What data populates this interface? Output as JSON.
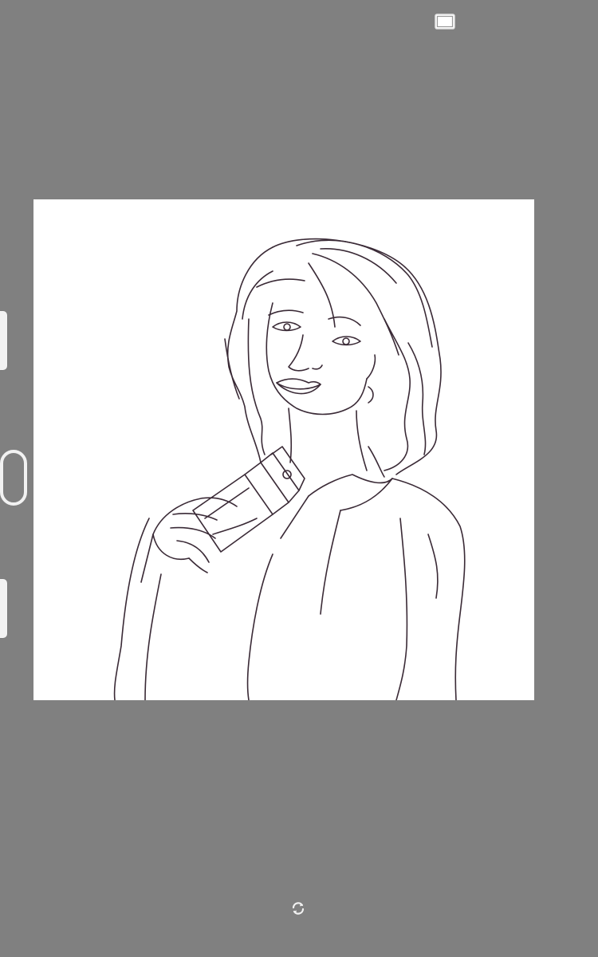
{
  "app": {
    "workspace_color": "#808080",
    "canvas_color": "#ffffff",
    "ink_color": "#3a2a36"
  },
  "toolbar": {
    "fullscreen_icon": "fullscreen-icon"
  },
  "sidebar": {
    "handles": [
      "sidebar-handle-top",
      "sidebar-ring",
      "sidebar-handle-bottom"
    ]
  },
  "footer": {
    "rotate_icon": "rotate-icon"
  },
  "canvas": {
    "content": "line-art-woman-with-perfume"
  }
}
